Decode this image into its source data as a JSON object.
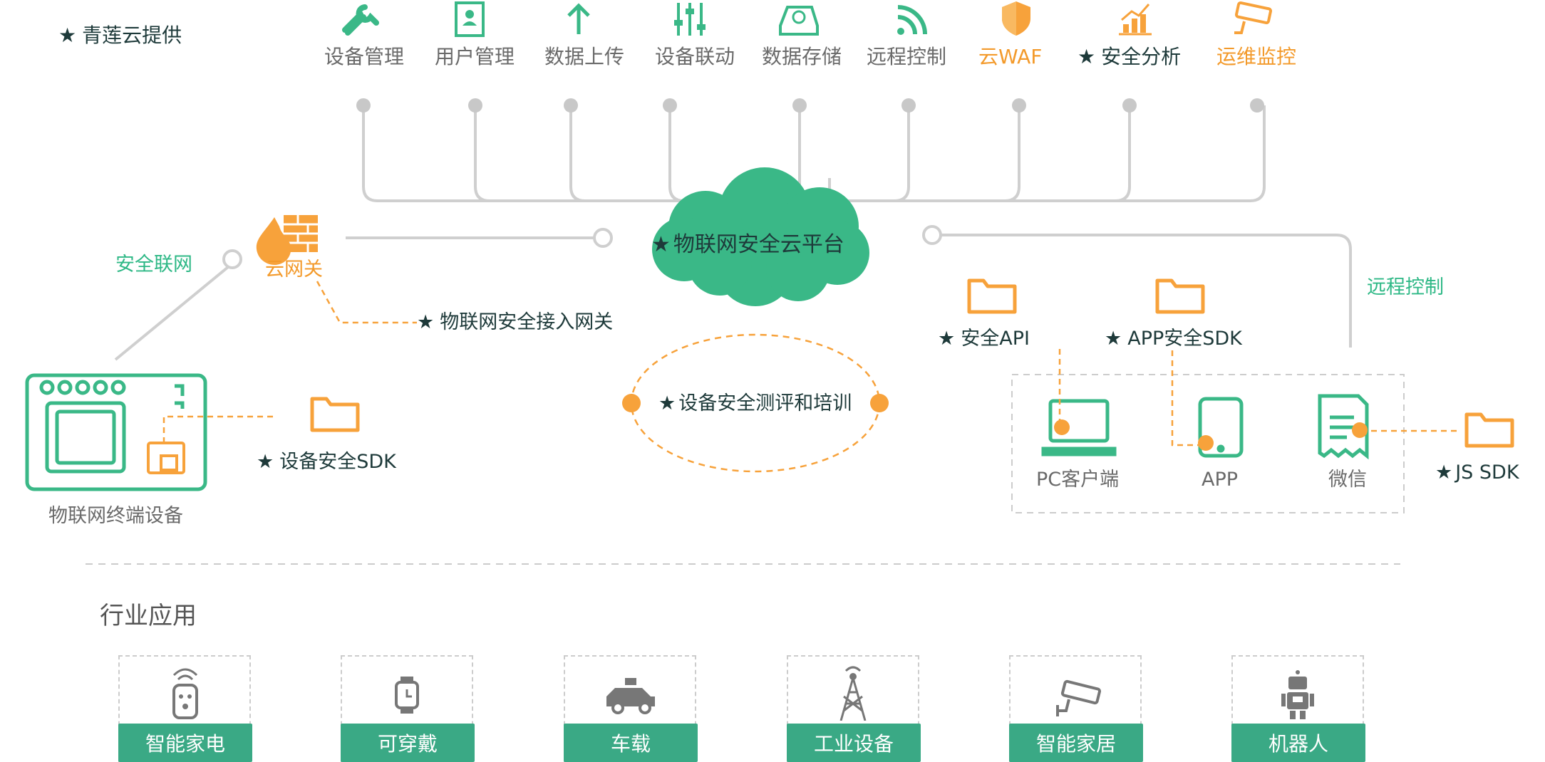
{
  "provider_note": "青莲云提供",
  "services": [
    {
      "label": "设备管理",
      "icon": "wrench-icon",
      "starred": false,
      "highlight": false
    },
    {
      "label": "用户管理",
      "icon": "user-card-icon",
      "starred": false,
      "highlight": false
    },
    {
      "label": "数据上传",
      "icon": "upload-arrow-icon",
      "starred": false,
      "highlight": false
    },
    {
      "label": "设备联动",
      "icon": "sliders-icon",
      "starred": false,
      "highlight": false
    },
    {
      "label": "数据存储",
      "icon": "storage-drive-icon",
      "starred": false,
      "highlight": false
    },
    {
      "label": "远程控制",
      "icon": "wifi-signal-icon",
      "starred": false,
      "highlight": false
    },
    {
      "label": "云WAF",
      "icon": "shield-icon",
      "starred": false,
      "highlight": true
    },
    {
      "label": "安全分析",
      "icon": "analytics-chart-icon",
      "starred": true,
      "highlight": false
    },
    {
      "label": "运维监控",
      "icon": "camera-icon",
      "starred": false,
      "highlight": true
    }
  ],
  "cloud_platform": "物联网安全云平台",
  "gateway": {
    "label": "云网关",
    "secure_link": "安全联网",
    "access_gateway": "物联网安全接入网关"
  },
  "terminal": {
    "label": "物联网终端设备",
    "sdk": "设备安全SDK"
  },
  "evaluation": "设备安全测评和培训",
  "client_side": {
    "api": "安全API",
    "app_sdk": "APP安全SDK",
    "remote_control": "远程控制",
    "pc_client": "PC客户端",
    "app": "APP",
    "wechat": "微信",
    "js_sdk": "JS SDK"
  },
  "industry": {
    "title": "行业应用",
    "items": [
      {
        "label": "智能家电",
        "icon": "remote-control-icon"
      },
      {
        "label": "可穿戴",
        "icon": "smartwatch-icon"
      },
      {
        "label": "车载",
        "icon": "car-icon"
      },
      {
        "label": "工业设备",
        "icon": "signal-tower-icon"
      },
      {
        "label": "智能家居",
        "icon": "security-camera-icon"
      },
      {
        "label": "机器人",
        "icon": "robot-icon"
      }
    ]
  },
  "colors": {
    "green": "#3ab887",
    "orange": "#f7a23b",
    "dark": "#1e3a3a",
    "line": "#cccccc"
  }
}
